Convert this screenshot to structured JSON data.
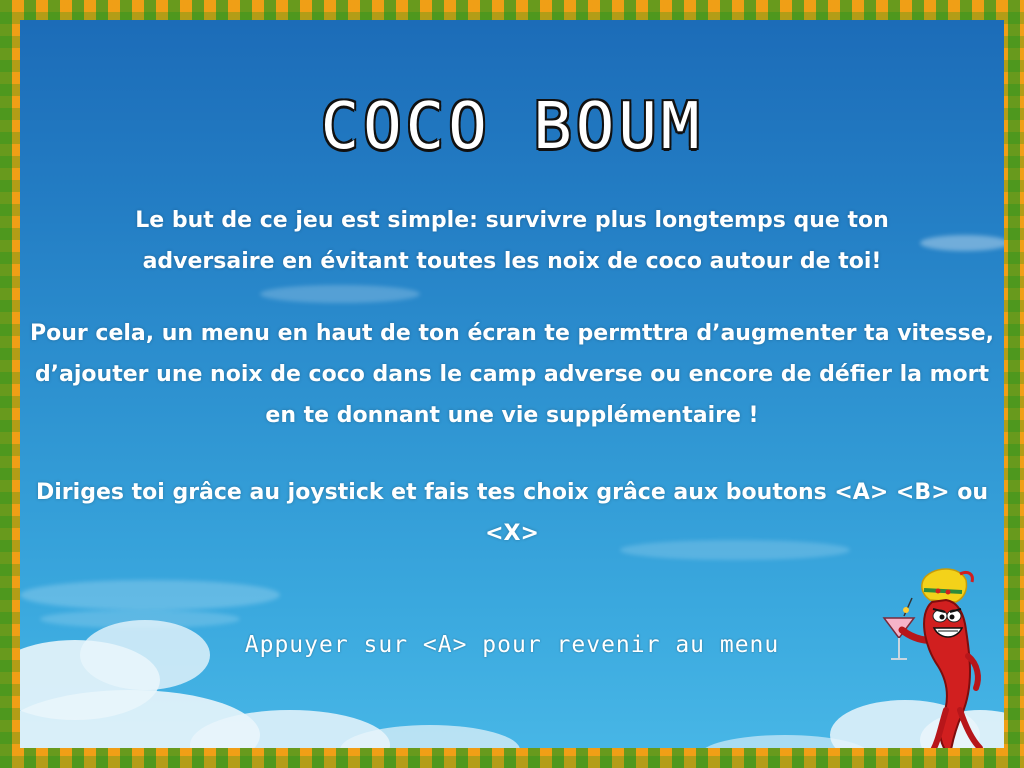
{
  "screen": {
    "title": "COCO BOUM",
    "paragraph1": [
      "Le but de ce jeu est simple: survivre plus longtemps que ton",
      "adversaire en évitant toutes les noix de coco autour de toi!"
    ],
    "paragraph2": [
      "Pour cela, un menu en haut de ton écran te permttra d’augmenter ta vitesse,",
      "d’ajouter une noix de coco dans le camp adverse ou encore de défier la mort",
      "en te donnant une vie supplémentaire !"
    ],
    "paragraph3": [
      "Diriges toi grâce au joystick et fais tes choix grâce aux boutons <A> <B> ou <X>"
    ],
    "back_hint": "Appuyer sur <A> pour revenir au menu"
  },
  "colors": {
    "border_green": "#6ab12f",
    "border_yellow": "#f5b724",
    "sky_top": "#1c6cb8",
    "sky_bottom": "#47b6e6",
    "text": "#ffffff",
    "pepper_red": "#d11f1f",
    "hat_yellow": "#f3d21a"
  },
  "icons": {
    "mascot": "chili-pepper-mascot-icon"
  }
}
